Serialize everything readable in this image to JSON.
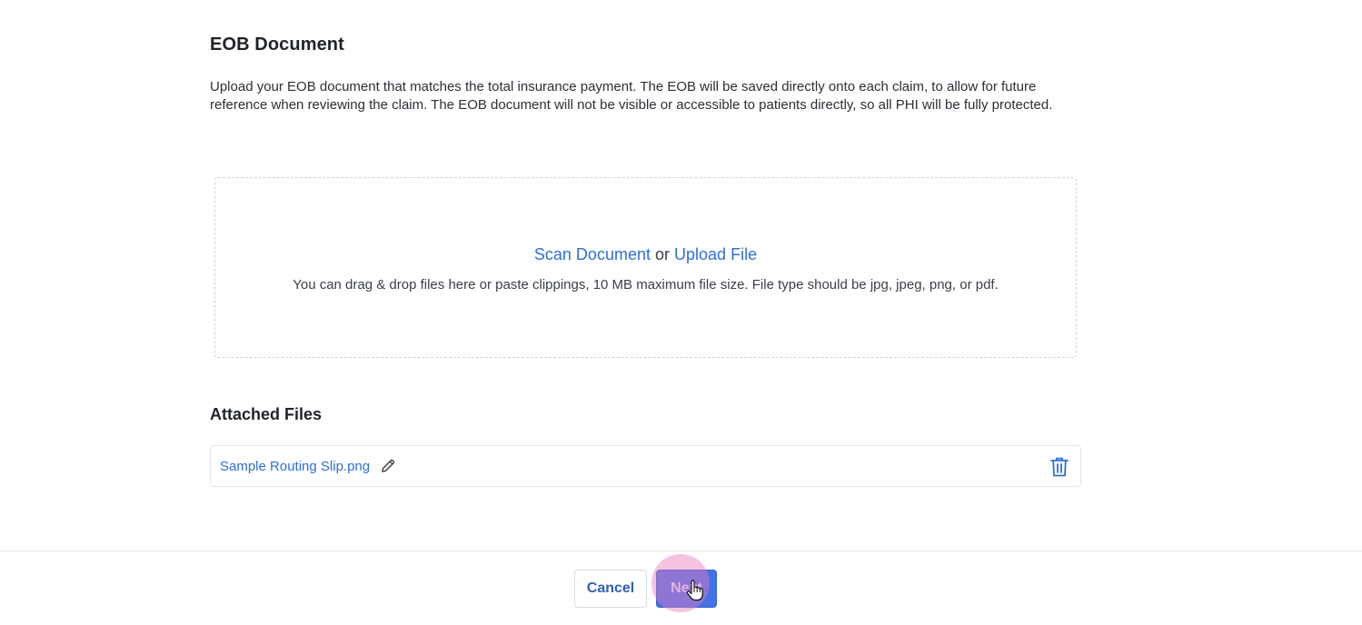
{
  "section": {
    "title": "EOB Document",
    "description": "Upload your EOB document that matches the total insurance payment. The EOB will be saved directly onto each claim, to allow for future reference when reviewing the claim. The EOB document will not be visible or accessible to patients directly, so all PHI will be fully protected."
  },
  "dropzone": {
    "scan_label": "Scan Document",
    "or_label": "or",
    "upload_label": "Upload File",
    "help_text": "You can drag & drop files here or paste clippings, 10 MB maximum file size. File type should be jpg, jpeg, png, or pdf."
  },
  "attached": {
    "title": "Attached Files",
    "files": [
      {
        "name": "Sample Routing Slip.png",
        "edit_icon": "pencil-icon",
        "delete_icon": "trash-icon"
      }
    ]
  },
  "footer": {
    "cancel_label": "Cancel",
    "next_label": "Next"
  },
  "colors": {
    "accent": "#2f6fd6",
    "primary_button": "#3f73e6",
    "click_highlight": "#ec78be"
  }
}
